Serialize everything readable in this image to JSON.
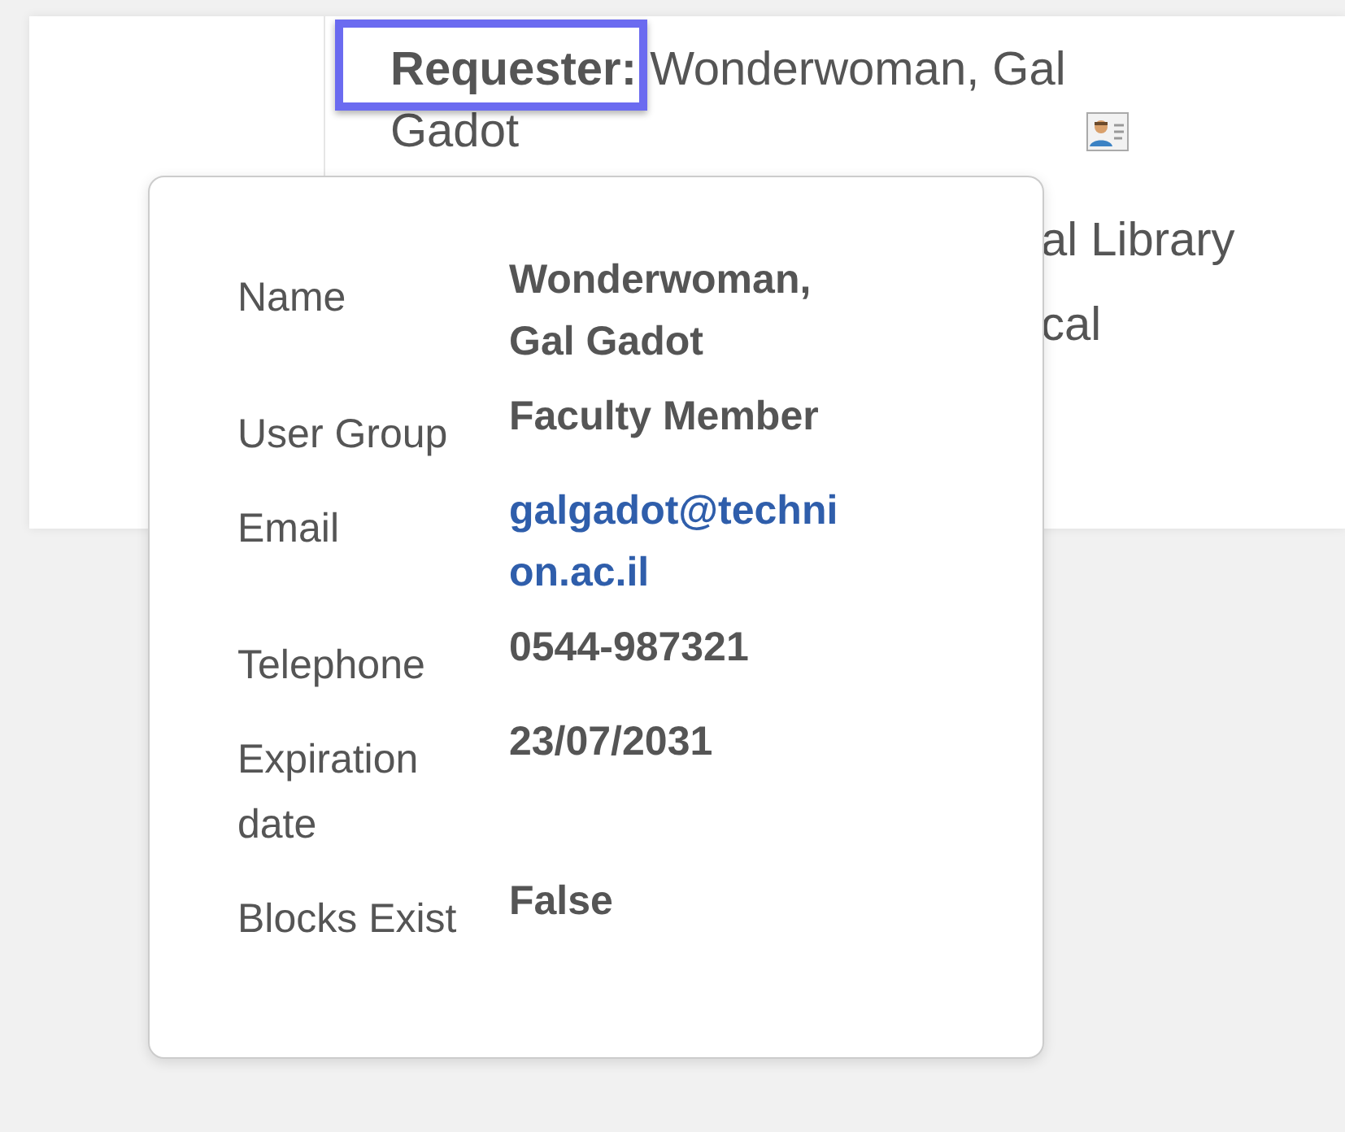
{
  "requester": {
    "label": "Requester:",
    "value": "Wonderwoman, Gal Gadot",
    "highlighted": true
  },
  "hidden_lines": [
    "al Library",
    "cal"
  ],
  "popover": {
    "rows": [
      {
        "label": "Name",
        "value": "Wonderwoman, Gal Gadot",
        "kind": "text"
      },
      {
        "label": "User Group",
        "value": "Faculty Member",
        "kind": "text"
      },
      {
        "label": "Email",
        "value": "galgadot@technion.ac.il",
        "kind": "link"
      },
      {
        "label": "Telephone",
        "value": "0544-987321",
        "kind": "text"
      },
      {
        "label": "Expiration date",
        "value": "23/07/2031",
        "kind": "text"
      },
      {
        "label": "Blocks Exist",
        "value": "False",
        "kind": "text"
      }
    ]
  }
}
